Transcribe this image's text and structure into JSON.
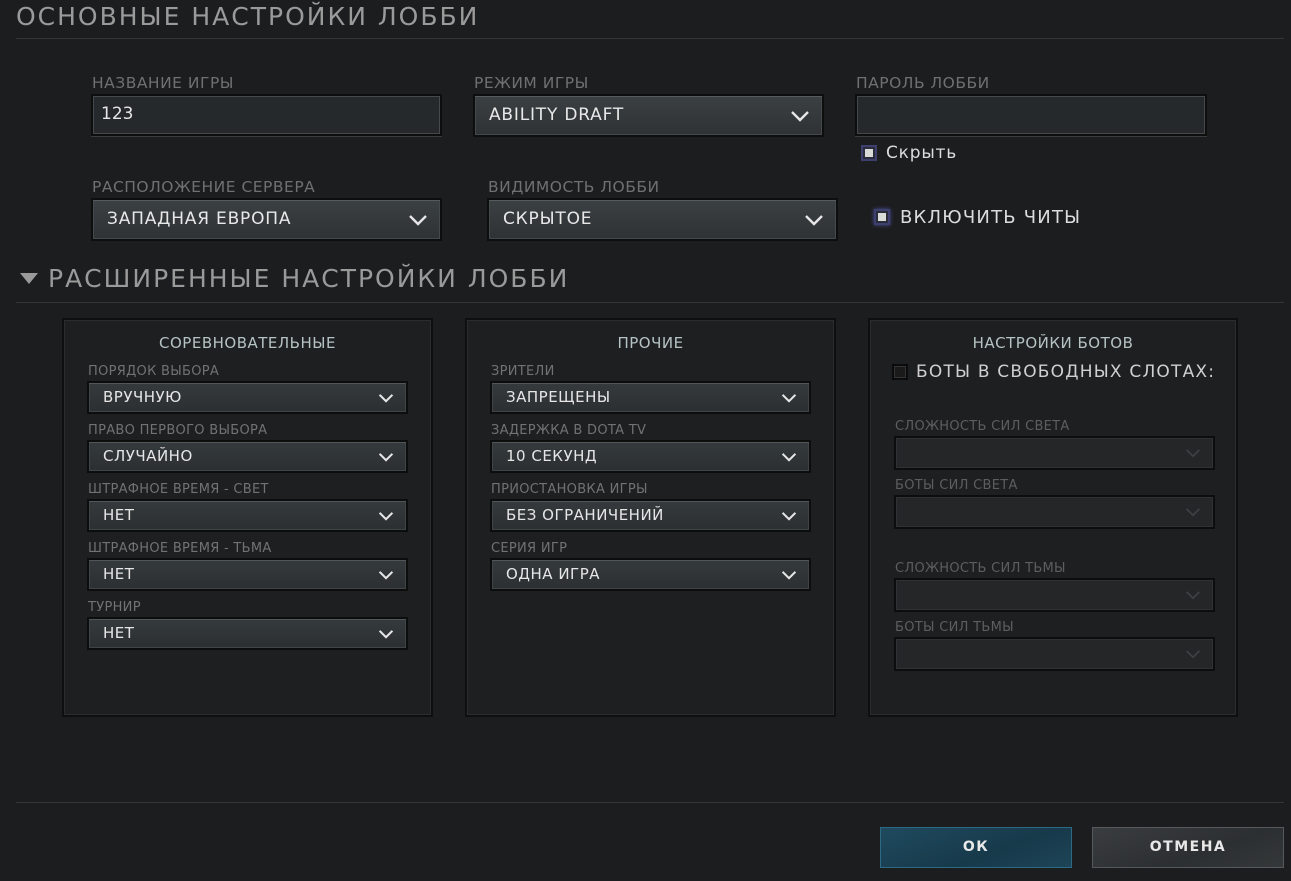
{
  "basic": {
    "title": "ОСНОВНЫЕ НАСТРОЙКИ ЛОББИ",
    "game_name": {
      "label": "НАЗВАНИЕ ИГРЫ",
      "value": "123"
    },
    "game_mode": {
      "label": "РЕЖИМ ИГРЫ",
      "value": "ABILITY DRAFT"
    },
    "password": {
      "label": "ПАРОЛЬ ЛОББИ",
      "value": ""
    },
    "hide": {
      "label": "Скрыть",
      "checked": true
    },
    "server": {
      "label": "РАСПОЛОЖЕНИЕ СЕРВЕРА",
      "value": "ЗАПАДНАЯ ЕВРОПА"
    },
    "visibility": {
      "label": "ВИДИМОСТЬ ЛОББИ",
      "value": "СКРЫТОЕ"
    },
    "cheats": {
      "label": "ВКЛЮЧИТЬ ЧИТЫ",
      "checked": true
    }
  },
  "advanced": {
    "title": "РАСШИРЕННЫЕ НАСТРОЙКИ ЛОББИ",
    "competitive": {
      "title": "СОРЕВНОВАТЕЛЬНЫЕ",
      "fields": [
        {
          "label": "ПОРЯДОК ВЫБОРА",
          "value": "ВРУЧНУЮ"
        },
        {
          "label": "ПРАВО ПЕРВОГО ВЫБОРА",
          "value": "СЛУЧАЙНО"
        },
        {
          "label": "ШТРАФНОЕ ВРЕМЯ - СВЕТ",
          "value": "НЕТ"
        },
        {
          "label": "ШТРАФНОЕ ВРЕМЯ - ТЬМА",
          "value": "НЕТ"
        },
        {
          "label": "ТУРНИР",
          "value": "НЕТ"
        }
      ]
    },
    "other": {
      "title": "ПРОЧИЕ",
      "fields": [
        {
          "label": "ЗРИТЕЛИ",
          "value": "ЗАПРЕЩЕНЫ"
        },
        {
          "label": "ЗАДЕРЖКА В DOTA TV",
          "value": "10 СЕКУНД"
        },
        {
          "label": "ПРИОСТАНОВКА ИГРЫ",
          "value": "БЕЗ ОГРАНИЧЕНИЙ"
        },
        {
          "label": "СЕРИЯ ИГР",
          "value": "ОДНА ИГРА"
        }
      ]
    },
    "bots": {
      "title": "НАСТРОЙКИ БОТОВ",
      "fill_slots": {
        "label": "БОТЫ В СВОБОДНЫХ СЛОТАХ:",
        "checked": false
      },
      "fields": [
        {
          "label": "СЛОЖНОСТЬ СИЛ СВЕТА",
          "value": ""
        },
        {
          "label": "БОТЫ СИЛ СВЕТА",
          "value": ""
        },
        {
          "label": "СЛОЖНОСТЬ СИЛ ТЬМЫ",
          "value": ""
        },
        {
          "label": "БОТЫ СИЛ ТЬМЫ",
          "value": ""
        }
      ]
    }
  },
  "buttons": {
    "ok": "ОК",
    "cancel": "ОТМЕНА"
  },
  "icons": {
    "dropdown": "chevron-down-icon",
    "collapse": "triangle-down-icon"
  }
}
